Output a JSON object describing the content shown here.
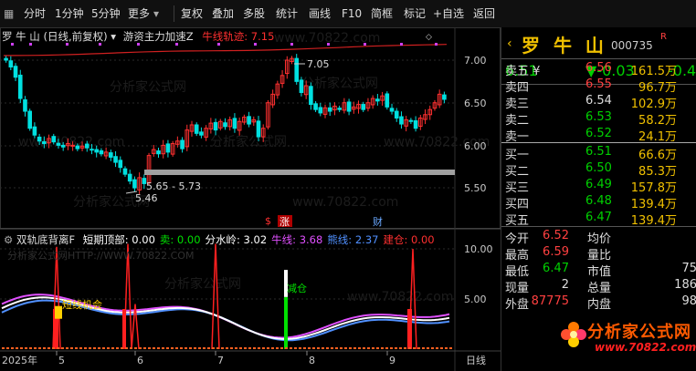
{
  "toolbar": {
    "left_items": [
      "分时",
      "1分钟",
      "5分钟",
      "更多"
    ],
    "more_arrow": "▾",
    "right_items": [
      "复权",
      "叠加",
      "多股",
      "统计",
      "画线",
      "F10",
      "简框",
      "标记",
      "+自选",
      "返回"
    ]
  },
  "main_info": {
    "name": "罗 牛 山",
    "mode": "(日线,前复权)",
    "indicator": "游资主力加速Z",
    "trail_label": "牛线轨迹:",
    "trail_value": "7.15"
  },
  "price_axis": [
    "7.00",
    "6.50",
    "6.00",
    "5.50"
  ],
  "annotations": {
    "high": "7.05",
    "low": "5.46",
    "range": "5.65 - 5.73"
  },
  "markers": {
    "zhang": "涨",
    "cai": "财",
    "duan_xian": "短线机会",
    "jian_cang": "减仓"
  },
  "sub_info": {
    "name": "双轨底背离F",
    "items": [
      {
        "label": "短期顶部:",
        "value": "0.00",
        "color": "#ffffff"
      },
      {
        "label": "卖:",
        "value": "0.00",
        "color": "#00e000"
      },
      {
        "label": "分水岭:",
        "value": "3.02",
        "color": "#ffffff"
      },
      {
        "label": "牛线:",
        "value": "3.68",
        "color": "#e050ff"
      },
      {
        "label": "熊线:",
        "value": "2.37",
        "color": "#5090ff"
      },
      {
        "label": "建仓:",
        "value": "0.00",
        "color": "#ff3030"
      }
    ]
  },
  "sub_axis": [
    "10.00",
    "5.00"
  ],
  "watermark": {
    "text": "分析家公式网",
    "url_text": "分析家公式网HTTP://WWW.70822.COM",
    "site": "www.70822.com"
  },
  "date_axis": {
    "labels": [
      "2025年",
      "5",
      "6",
      "7",
      "8",
      "9"
    ],
    "period": "日线"
  },
  "quote": {
    "name": "罗 牛 山",
    "code": "000735",
    "r_mark": "R",
    "last": "6.51",
    "change": "▼-0.03",
    "pct": "-0.4",
    "asks": [
      {
        "label": "卖五 ¥",
        "price": "6.56",
        "vol": "161.5万"
      },
      {
        "label": "卖四",
        "price": "6.55",
        "vol": "96.7万"
      },
      {
        "label": "卖三",
        "price": "6.54",
        "vol": "102.9万"
      },
      {
        "label": "卖二",
        "price": "6.53",
        "vol": "58.2万"
      },
      {
        "label": "卖一",
        "price": "6.52",
        "vol": "24.1万"
      }
    ],
    "bids": [
      {
        "label": "买一",
        "price": "6.51",
        "vol": "66.6万"
      },
      {
        "label": "买二",
        "price": "6.50",
        "vol": "85.3万"
      },
      {
        "label": "买三",
        "price": "6.49",
        "vol": "157.8万"
      },
      {
        "label": "买四",
        "price": "6.48",
        "vol": "139.4万"
      },
      {
        "label": "买五",
        "price": "6.47",
        "vol": "139.4万"
      }
    ],
    "stats": [
      {
        "l1": "今开",
        "v1": "6.52",
        "c1": "#ff4040",
        "l2": "均价",
        "v2": ""
      },
      {
        "l1": "最高",
        "v1": "6.59",
        "c1": "#ff4040",
        "l2": "量比",
        "v2": ""
      },
      {
        "l1": "最低",
        "v1": "6.47",
        "c1": "#00d000",
        "l2": "市值",
        "v2": "75"
      },
      {
        "l1": "现量",
        "v1": "2",
        "c1": "#dddddd",
        "l2": "总量",
        "v2": "186"
      },
      {
        "l1": "外盘",
        "v1": "87775",
        "c1": "#ff4040",
        "l2": "内盘",
        "v2": "98"
      }
    ]
  },
  "colors": {
    "up": "#ff3030",
    "down": "#00e0e0",
    "bull_line": "#e050ff",
    "bear_line": "#5090ff",
    "white_line": "#ffffff",
    "trail_line": "#d02020"
  },
  "logo": {
    "title": "分析家公式网",
    "url": "www.70822.com"
  }
}
